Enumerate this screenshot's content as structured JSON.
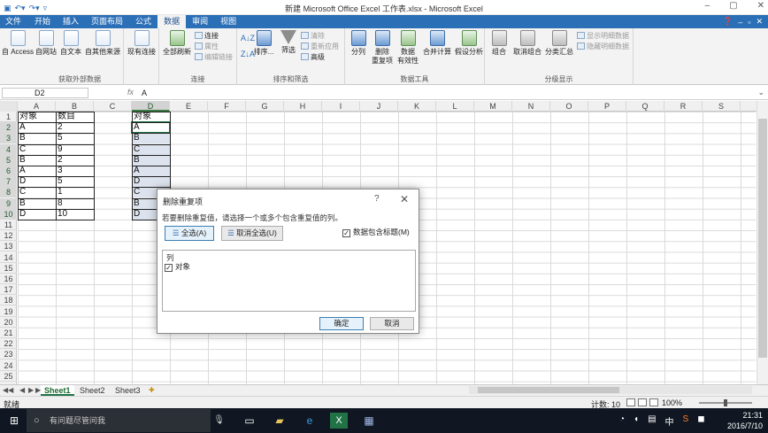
{
  "window": {
    "title": "新建 Microsoft Office Excel 工作表.xlsx - Microsoft Excel",
    "controls": [
      "–",
      "▢",
      "✕"
    ]
  },
  "qat": {
    "save_icon": "save-icon",
    "undo_icon": "undo-icon",
    "redo_icon": "redo-icon"
  },
  "tabs": [
    {
      "label": "文件"
    },
    {
      "label": "开始"
    },
    {
      "label": "插入"
    },
    {
      "label": "页面布局"
    },
    {
      "label": "公式"
    },
    {
      "label": "数据"
    },
    {
      "label": "审阅"
    },
    {
      "label": "视图"
    }
  ],
  "active_tab": "数据",
  "ribbon": {
    "get_external": {
      "label": "获取外部数据",
      "access": "自 Access",
      "web": "自网站",
      "text": "自文本",
      "other": "自其他来源",
      "existing": "现有连接"
    },
    "connections": {
      "label": "连接",
      "refresh_all": "全部刷新",
      "connections": "连接",
      "properties": "属性",
      "edit_links": "编辑链接"
    },
    "sort_filter": {
      "label": "排序和筛选",
      "sort": "排序...",
      "filter": "筛选",
      "clear": "清除",
      "reapply": "重新应用",
      "advanced": "高级"
    },
    "data_tools": {
      "label": "数据工具",
      "text_to_columns": "分列",
      "remove_dup_1": "删除",
      "remove_dup_2": "重复项",
      "validation_1": "数据",
      "validation_2": "有效性",
      "consolidate": "合并计算",
      "what_if": "假设分析"
    },
    "outline": {
      "label": "分级显示",
      "group": "组合",
      "ungroup": "取消组合",
      "subtotal": "分类汇总",
      "show_detail": "显示明细数据",
      "hide_detail": "隐藏明细数据"
    }
  },
  "formula_bar": {
    "name_box": "D2",
    "fx": "fx",
    "value": "A"
  },
  "columns": [
    "A",
    "B",
    "C",
    "D",
    "E",
    "F",
    "G",
    "H",
    "I",
    "J",
    "K",
    "L",
    "M",
    "N",
    "O",
    "P",
    "Q",
    "R",
    "S"
  ],
  "selected_column": "D",
  "rows": [
    "1",
    "2",
    "3",
    "4",
    "5",
    "6",
    "7",
    "8",
    "9",
    "10",
    "11",
    "12",
    "13",
    "14",
    "15",
    "16",
    "17",
    "18",
    "19",
    "20",
    "21",
    "22",
    "23",
    "24",
    "25"
  ],
  "table_ab": {
    "header": [
      "对象",
      "数目"
    ],
    "rows": [
      [
        "A",
        "2"
      ],
      [
        "B",
        "5"
      ],
      [
        "C",
        "9"
      ],
      [
        "B",
        "2"
      ],
      [
        "A",
        "3"
      ],
      [
        "D",
        "5"
      ],
      [
        "C",
        "1"
      ],
      [
        "B",
        "8"
      ],
      [
        "D",
        "10"
      ]
    ]
  },
  "table_d": {
    "header": "对象",
    "rows": [
      "A",
      "B",
      "C",
      "B",
      "A",
      "D",
      "C",
      "B",
      "D"
    ]
  },
  "dialog": {
    "title": "删除重复项",
    "help": "?",
    "close": "✕",
    "message": "若要删除重复值，请选择一个或多个包含重复值的列。",
    "select_all": "全选(A)",
    "unselect_all": "取消全选(U)",
    "has_headers": "数据包含标题(M)",
    "has_headers_checked": true,
    "list_header": "列",
    "list_items": [
      {
        "label": "对象",
        "checked": true
      }
    ],
    "ok": "确定",
    "cancel": "取消"
  },
  "sheets": [
    "Sheet1",
    "Sheet2",
    "Sheet3"
  ],
  "active_sheet": "Sheet1",
  "status": {
    "ready": "就绪",
    "count": "计数: 10",
    "zoom": "100%"
  },
  "taskbar": {
    "search_placeholder": "有问题尽管问我",
    "time": "21:31",
    "date": "2016/7/10",
    "ime": "中"
  },
  "colors": {
    "ribbon_blue": "#2b6fb7",
    "excel_green": "#217346",
    "selection": "#dde3ee"
  }
}
